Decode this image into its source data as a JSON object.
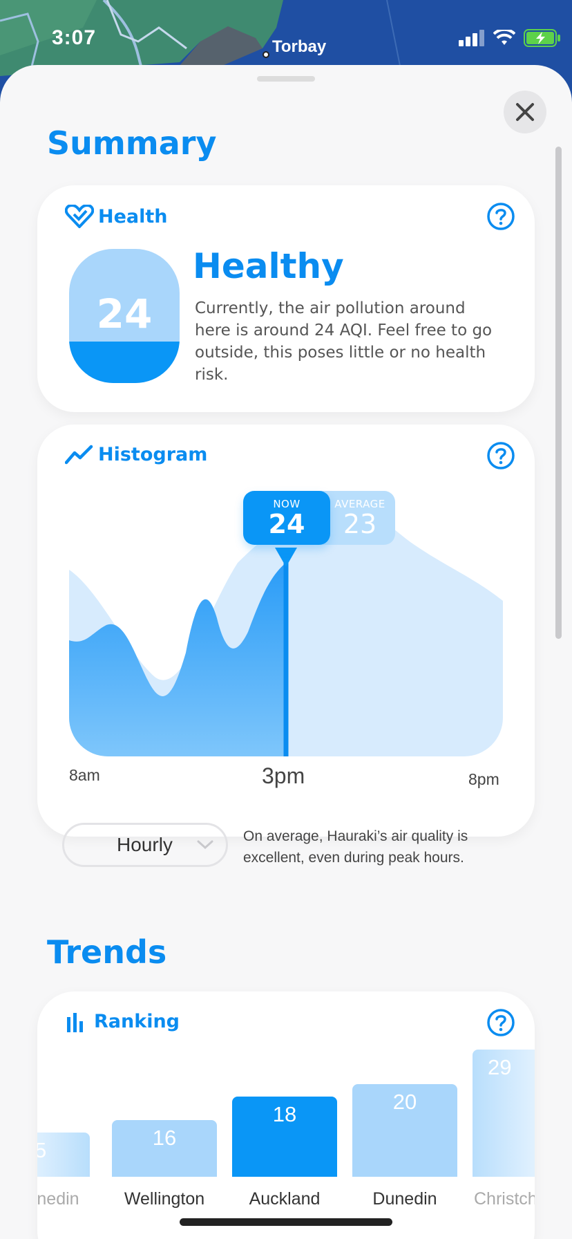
{
  "status": {
    "time": "3:07",
    "location": "Torbay"
  },
  "summary": {
    "title": "Summary",
    "health": {
      "header": "Health",
      "aqi": "24",
      "aqi_fill_fraction": 0.31,
      "status": "Healthy",
      "description": "Currently, the air pollution around here is around 24 AQI. Feel free to go outside, this poses little or no health risk."
    },
    "histogram": {
      "header": "Histogram",
      "now_label": "NOW",
      "now_value": "24",
      "average_label": "AVERAGE",
      "average_value": "23",
      "x_start": "8am",
      "x_mid": "3pm",
      "x_end": "8pm",
      "period_select": "Hourly",
      "note": "On average, Hauraki’s air quality is excellent, even during peak hours."
    }
  },
  "trends": {
    "title": "Trends",
    "ranking": {
      "header": "Ranking",
      "bars": [
        {
          "label": "nedin",
          "value": "5"
        },
        {
          "label": "Wellington",
          "value": "16"
        },
        {
          "label": "Auckland",
          "value": "18"
        },
        {
          "label": "Dunedin",
          "value": "20"
        },
        {
          "label": "Christch",
          "value": "29"
        }
      ]
    }
  },
  "colors": {
    "accent": "#0a8cf0",
    "bar_highlight": "#0a96f6",
    "bar_light": "#a9d6fb"
  }
}
